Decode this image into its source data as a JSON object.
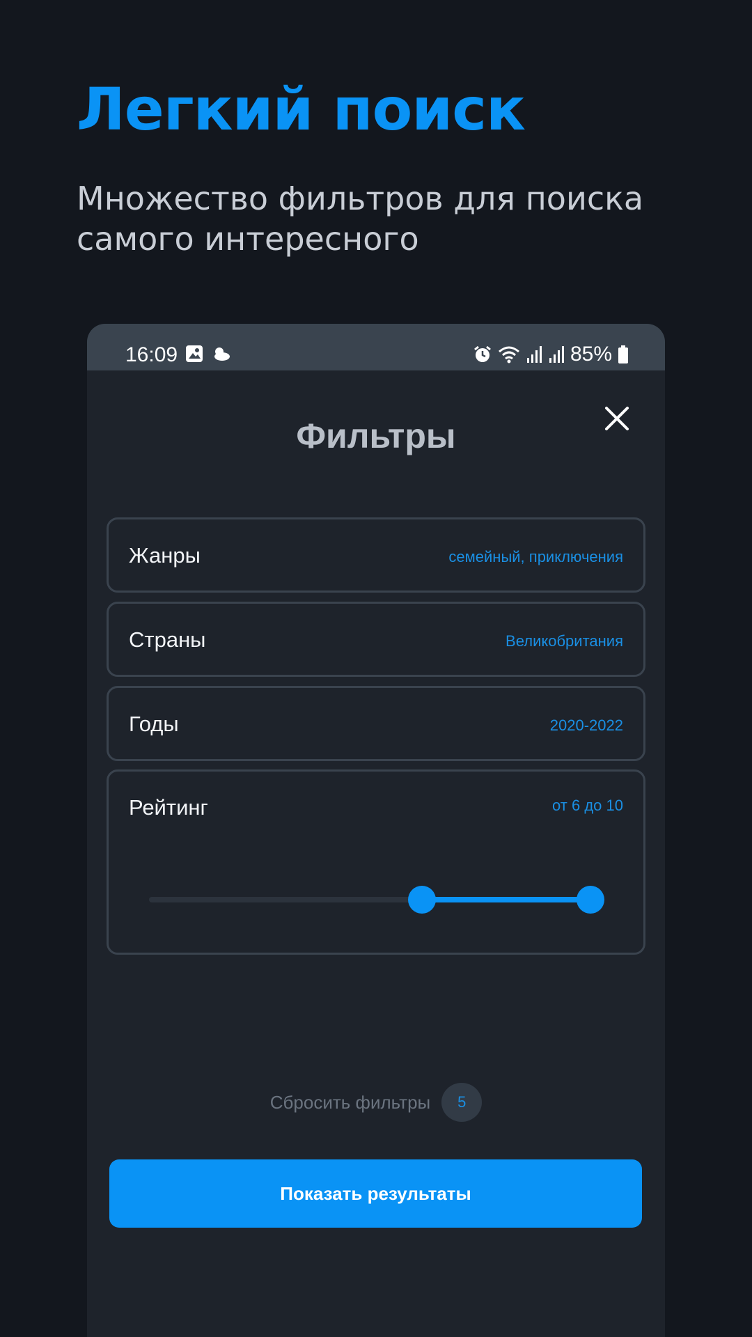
{
  "promo": {
    "title": "Легкий поиск",
    "subtitle": "Множество фильтров для поиска самого интересного"
  },
  "status_bar": {
    "time": "16:09",
    "battery": "85%",
    "icons_left": [
      "gallery-icon",
      "weather-icon"
    ],
    "icons_right": [
      "alarm-icon",
      "wifi-icon",
      "signal-icon",
      "signal-icon",
      "battery-icon"
    ]
  },
  "sheet": {
    "title": "Фильтры",
    "close_icon": "close-icon"
  },
  "filters": [
    {
      "label": "Жанры",
      "value": "семейный, приключения"
    },
    {
      "label": "Страны",
      "value": "Великобритания"
    },
    {
      "label": "Годы",
      "value": "2020-2022"
    },
    {
      "label": "Рейтинг",
      "value": "от 6 до 10"
    }
  ],
  "rating_slider": {
    "min": 0,
    "max": 10,
    "low": 6,
    "high": 10
  },
  "reset": {
    "label": "Сбросить фильтры",
    "count": "5"
  },
  "show_results_label": "Показать результаты",
  "colors": {
    "accent": "#0a93f5",
    "background": "#13171e",
    "sheet": "#1e232b",
    "border": "#3a434e"
  }
}
